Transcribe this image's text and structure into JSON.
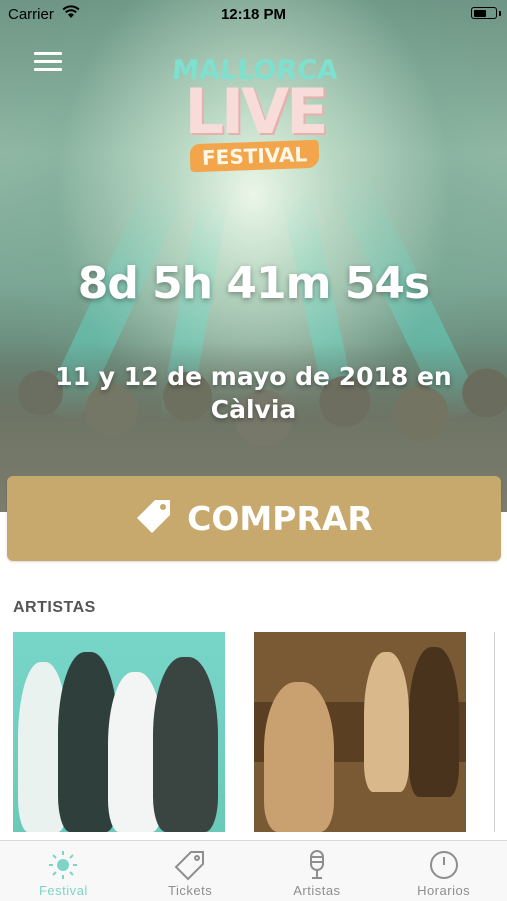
{
  "status_bar": {
    "carrier": "Carrier",
    "time": "12:18 PM",
    "battery_level": 0.6
  },
  "logo": {
    "line1": "MALLORCA",
    "line2": "LIVE",
    "line3": "FESTIVAL"
  },
  "countdown": "8d 5h 41m 54s",
  "event_date": "11 y 12 de mayo de 2018 en Càlvia",
  "buy_button": {
    "label": "COMPRAR",
    "icon": "tag-icon"
  },
  "artists_section": {
    "title": "ARTISTAS"
  },
  "colors": {
    "accent": "#7fd4c8",
    "buy_button": "#c7a96e",
    "tab_inactive": "#8e8e8e"
  },
  "tabs": [
    {
      "label": "Festival",
      "icon": "sun-icon",
      "active": true
    },
    {
      "label": "Tickets",
      "icon": "ticket-tag-icon",
      "active": false
    },
    {
      "label": "Artistas",
      "icon": "microphone-icon",
      "active": false
    },
    {
      "label": "Horarios",
      "icon": "clock-icon",
      "active": false
    }
  ]
}
